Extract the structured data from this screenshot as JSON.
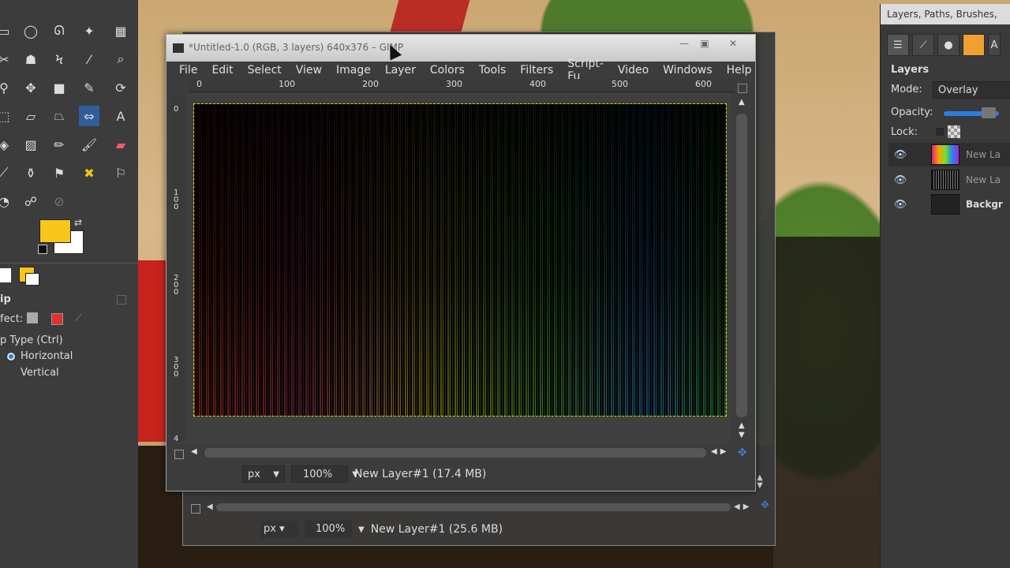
{
  "window": {
    "title": "*Untitled-1.0 (RGB, 3 layers) 640x376 – GIMP",
    "minimize_icon": "minimize-icon",
    "maximize_icon": "maximize-icon",
    "close_icon": "close-icon"
  },
  "menu": [
    "File",
    "Edit",
    "Select",
    "View",
    "Image",
    "Layer",
    "Colors",
    "Tools",
    "Filters",
    "Script-Fu",
    "Video",
    "Windows",
    "Help"
  ],
  "ruler": {
    "h_ticks": [
      "0",
      "100",
      "200",
      "300",
      "400",
      "500",
      "600"
    ],
    "v_ticks": [
      "0",
      "100",
      "200",
      "300",
      "4"
    ]
  },
  "status": {
    "unit": "px",
    "zoom": "100%",
    "layer_info": "New Layer#1 (17.4 MB)"
  },
  "back_window": {
    "unit": "px",
    "zoom": "100%",
    "layer_info": "New Layer#1 (25.6 MB)"
  },
  "tool_options": {
    "title": "ip",
    "effect_label": "fect:",
    "flip_type_label": "p Type  (Ctrl)",
    "horizontal": "Horizontal",
    "vertical": "Vertical"
  },
  "dock": {
    "title": "Layers, Paths, Brushes, Patte",
    "section": "Layers",
    "mode_label": "Mode:",
    "mode_value": "Overlay",
    "opacity_label": "Opacity:",
    "lock_label": "Lock:",
    "layers": [
      {
        "name": "New La",
        "bold": false
      },
      {
        "name": "New La",
        "bold": false
      },
      {
        "name": "Backgr",
        "bold": true
      }
    ]
  },
  "colors": {
    "foreground": "#f8c51a",
    "background": "#ffffff",
    "accent": "#2b7de1",
    "selection": "#e5d100"
  }
}
